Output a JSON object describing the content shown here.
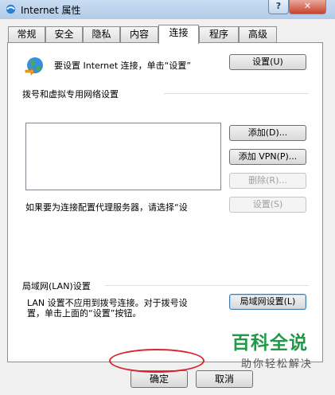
{
  "window": {
    "title": "Internet 属性",
    "help_label": "?",
    "close_label": "✕"
  },
  "tabs": [
    {
      "label": "常规",
      "active": false
    },
    {
      "label": "安全",
      "active": false
    },
    {
      "label": "隐私",
      "active": false
    },
    {
      "label": "内容",
      "active": false
    },
    {
      "label": "连接",
      "active": true
    },
    {
      "label": "程序",
      "active": false
    },
    {
      "label": "高级",
      "active": false
    }
  ],
  "setup": {
    "text": "要设置 Internet 连接，单击“设置”",
    "button": "设置(U)"
  },
  "dialup": {
    "group_title": "拨号和虚拟专用网络设置",
    "add_button": "添加(D)...",
    "add_vpn_button": "添加 VPN(P)...",
    "delete_button": "删除(R)...",
    "proxy_text": "如果要为连接配置代理服务器，请选择“设",
    "settings_button": "设置(S)"
  },
  "lan": {
    "group_title": "局域网(LAN)设置",
    "text_line1": "LAN 设置不应用到拨号连接。对于拨号设",
    "text_line2": "置，单击上面的“设置”按钮。",
    "button": "局域网设置(L)"
  },
  "footer": {
    "ok_button": "确定",
    "cancel_button": "取消"
  },
  "watermark": {
    "title": "百科全说",
    "subtitle": "助你轻松解决"
  },
  "colors": {
    "annotation_ellipse": "#d9232c",
    "watermark_green": "#1f9b45"
  }
}
